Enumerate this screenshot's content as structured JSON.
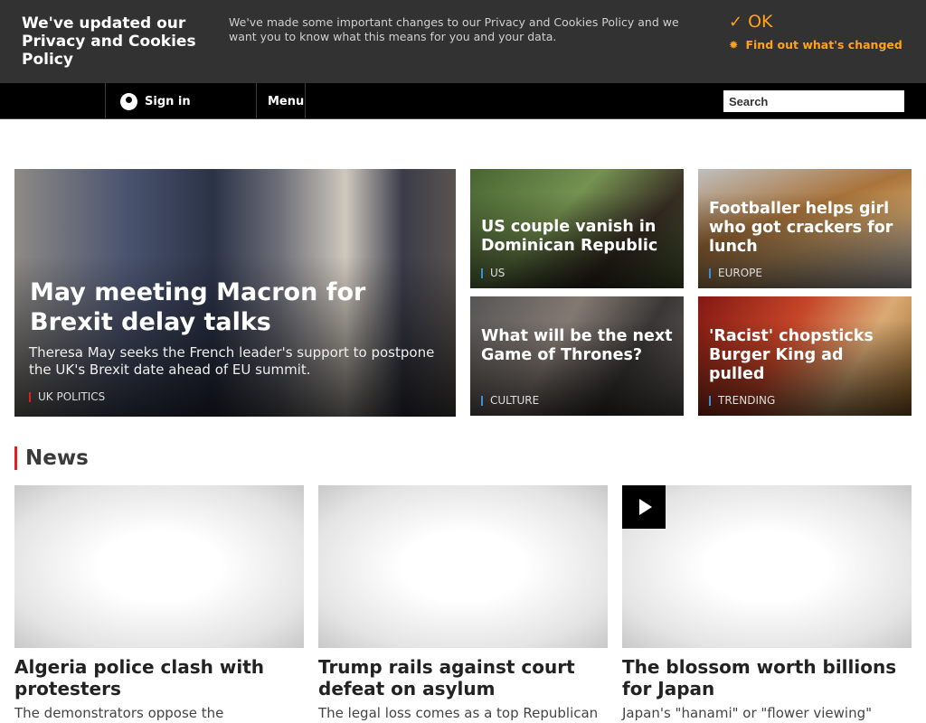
{
  "cookie": {
    "title": "We've updated our Privacy and Cookies Policy",
    "text": "We've made some important changes to our Privacy and Cookies Policy and we want you to know what this means for you and your data.",
    "ok": "OK",
    "find_out": "Find out what's changed"
  },
  "nav": {
    "sign_in": "Sign in",
    "menu": "Menu",
    "search_placeholder": "Search"
  },
  "hero": {
    "title": "May meeting Macron for Brexit delay talks",
    "summary": "Theresa May seeks the French leader's support to postpone the UK's Brexit date ahead of EU summit.",
    "tag": "UK POLITICS"
  },
  "cards": [
    {
      "title": "US couple vanish in Dominican Republic",
      "tag": "US"
    },
    {
      "title": "Footballer helps girl who got crackers for lunch",
      "tag": "EUROPE"
    },
    {
      "title": "What will be the next Game of Thrones?",
      "tag": "CULTURE"
    },
    {
      "title": "'Racist' chopsticks Burger King ad pulled",
      "tag": "TRENDING"
    }
  ],
  "news": {
    "heading": "News",
    "stories": [
      {
        "title": "Algeria police clash with protesters",
        "summary": "The demonstrators oppose the"
      },
      {
        "title": "Trump rails against court defeat on asylum",
        "summary": "The legal loss comes as a top Republican"
      },
      {
        "title": "The blossom worth billions for Japan",
        "summary": "Japan's \"hanami\" or \"flower viewing\""
      }
    ]
  }
}
